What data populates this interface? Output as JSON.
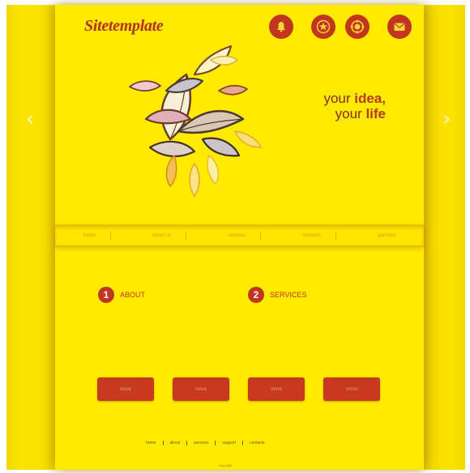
{
  "header": {
    "logo": "Sitetemplate",
    "icons": [
      "bell-icon",
      "star-icon",
      "target-icon",
      "mail-icon"
    ]
  },
  "hero": {
    "tagline_line1_prefix": "your ",
    "tagline_line1_bold": "idea,",
    "tagline_line2_prefix": "your ",
    "tagline_line2_bold": "life",
    "left_arrow": "‹",
    "right_arrow": "›"
  },
  "nav": {
    "items": [
      "home",
      "about us",
      "services",
      "contacts",
      "partners"
    ]
  },
  "sections": [
    {
      "number": "1",
      "label": "ABOUT"
    },
    {
      "number": "2",
      "label": "SERVICES"
    }
  ],
  "buttons": [
    "more",
    "more",
    "more",
    "more"
  ],
  "footer": {
    "links": [
      "home",
      "about",
      "services",
      "support",
      "contacts"
    ],
    "copyright": "copyright"
  },
  "colors": {
    "background": "#ffea00",
    "accent": "#c2361f",
    "text_dark": "#8a2a16"
  }
}
